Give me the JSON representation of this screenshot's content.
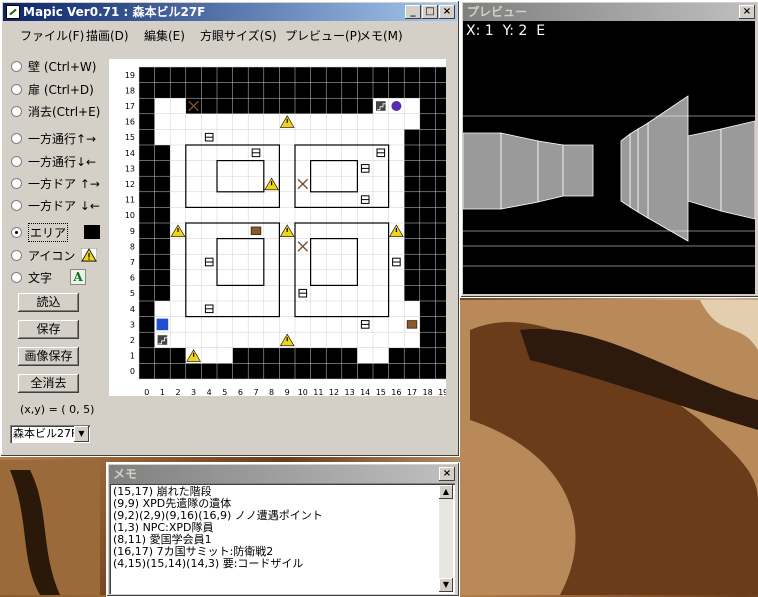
{
  "main_window": {
    "title": "Mapic Ver0.71 : 森本ビル27F",
    "menu": [
      "ファイル(F)",
      "描画(D)",
      "編集(E)",
      "方眼サイズ(S)",
      "プレビュー(P)",
      "メモ(M)"
    ],
    "tools": [
      {
        "label": "壁 (Ctrl+W)",
        "selected": false
      },
      {
        "label": "扉 (Ctrl+D)",
        "selected": false
      },
      {
        "label": "消去(Ctrl+E)",
        "selected": false
      },
      {
        "label": "一方通行↑→",
        "selected": false
      },
      {
        "label": "一方通行↓←",
        "selected": false
      },
      {
        "label": "一方ドア ↑→",
        "selected": false
      },
      {
        "label": "一方ドア ↓←",
        "selected": false
      },
      {
        "label": "エリア",
        "selected": true
      },
      {
        "label": "アイコン",
        "selected": false
      },
      {
        "label": "文字",
        "selected": false
      }
    ],
    "text_tool_glyph": "A",
    "buttons": {
      "load": "読込",
      "save": "保存",
      "save_image": "画像保存",
      "clear_all": "全消去"
    },
    "coord_readout": "(x,y) = ( 0, 5)",
    "floor_select": "森本ビル27F",
    "grid_labels": [
      "0",
      "1",
      "2",
      "3",
      "4",
      "5",
      "6",
      "7",
      "8",
      "9",
      "10",
      "11",
      "12",
      "13",
      "14",
      "15",
      "16",
      "17",
      "18",
      "19"
    ]
  },
  "preview_window": {
    "title": "プレビュー",
    "position_text": "X: 1  Y: 2  E"
  },
  "memo_window": {
    "title": "メモ",
    "lines": [
      "(15,17) 崩れた階段",
      "(9,9) XPD先遣隊の遺体",
      "(9,2)(2,9)(9,16)(16,9) ノノ遭遇ポイント",
      "(1,3) NPC:XPD隊員",
      "(8,11) 愛国学会員1",
      "(16,17) 7カ国サミット:防衛戦2",
      "(4,15)(15,14)(14,3)  要:コードザイル"
    ]
  },
  "colors": {
    "title_active": "#0a246a",
    "title_inactive": "#808080",
    "area_fill": "#000000",
    "warning": "#f2d21a"
  }
}
